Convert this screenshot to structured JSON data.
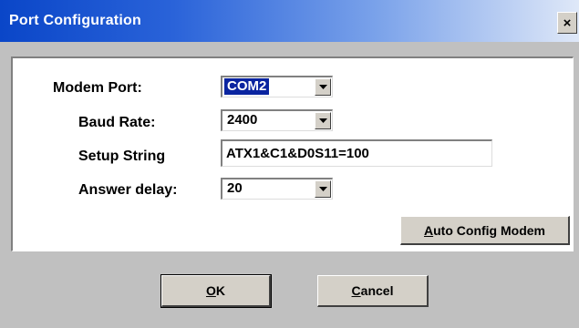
{
  "window": {
    "title": "Port Configuration",
    "close_glyph": "×"
  },
  "form": {
    "modem_port": {
      "label": "Modem Port:",
      "value": "COM2"
    },
    "baud_rate": {
      "label": "Baud Rate:",
      "value": "2400"
    },
    "setup_string": {
      "label": "Setup String",
      "value": "ATX1&C1&D0S11=100"
    },
    "answer_delay": {
      "label": "Answer delay:",
      "value": "20"
    }
  },
  "buttons": {
    "auto_config": {
      "mnemonic": "A",
      "rest": "uto Config Modem"
    },
    "ok": {
      "mnemonic": "O",
      "rest": "K"
    },
    "cancel": {
      "mnemonic": "C",
      "rest": "ancel"
    }
  },
  "colors": {
    "title_start": "#0a46c8",
    "selection": "#0a24a0",
    "face": "#d4d0c8",
    "body": "#c0c0c0"
  },
  "icons": {
    "close": "close-icon",
    "dropdown": "chevron-down-icon"
  }
}
